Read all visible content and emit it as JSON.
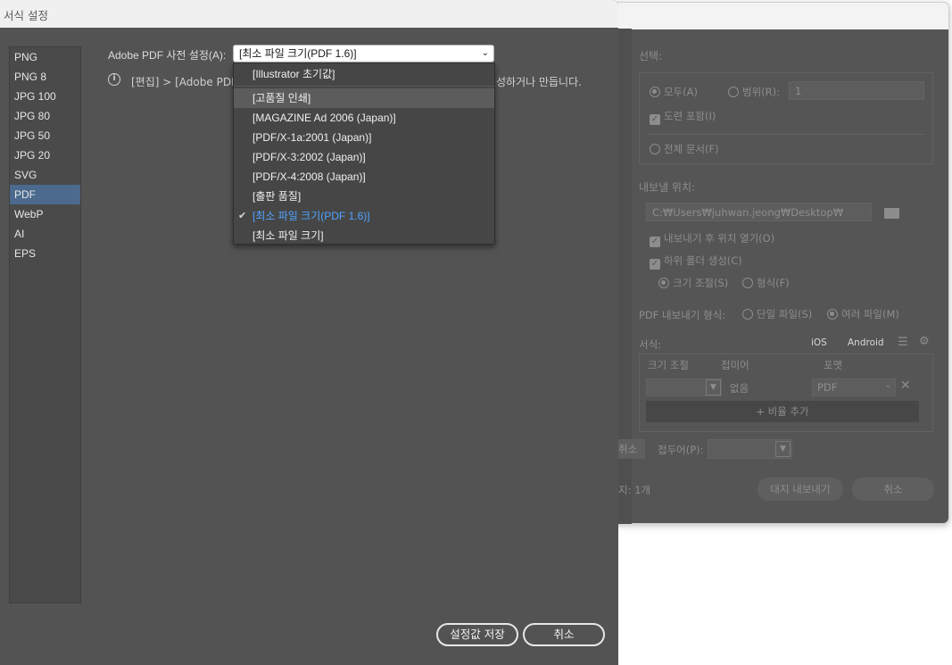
{
  "main_dialog": {
    "title": "서식 설정",
    "formats": [
      "PNG",
      "PNG 8",
      "JPG 100",
      "JPG 80",
      "JPG 50",
      "JPG 20",
      "SVG",
      "PDF",
      "WebP",
      "AI",
      "EPS"
    ],
    "selected_format": "PDF",
    "preset_label": "Adobe PDF 사전 설정(A):",
    "preset_value": "[최소 파일 크기(PDF 1.6)]",
    "info_prefix": "[편집] > [Adobe PDF",
    "info_suffix": "성하거나 만듭니다.",
    "dropdown_options": [
      "[Illustrator 초기값]",
      "[고품질 인쇄]",
      "[MAGAZINE Ad 2006 (Japan)]",
      "[PDF/X-1a:2001 (Japan)]",
      "[PDF/X-3:2002 (Japan)]",
      "[PDF/X-4:2008 (Japan)]",
      "[출판 품질]",
      "[최소 파일 크기(PDF 1.6)]",
      "[최소 파일 크기]"
    ],
    "hovered_option_index": 1,
    "checked_option_index": 7,
    "save_button": "설정값 저장",
    "cancel_button": "취소",
    "colors": {
      "selection": "#4b6a8e",
      "checked_text": "#4fa3ff",
      "panel": "#535353"
    }
  },
  "background_dialog": {
    "select_label": "선택:",
    "radio_all": "모두(A)",
    "radio_range": "범위(R):",
    "range_value": "1",
    "include_bleed": "도련 포함(I)",
    "entire_document": "전체 문서(F)",
    "export_location_label": "내보낼 위치:",
    "path": "C:₩Users₩juhwan.jeong₩Desktop₩",
    "open_after_export": "내보내기 후 위치 열기(O)",
    "create_subfolders": "하위 폴더 생성(C)",
    "radio_scale": "크기 조절(S)",
    "radio_format": "형식(F)",
    "pdf_export_type_label": "PDF 내보내기 형식:",
    "radio_single_file": "단일 파일(S)",
    "radio_multiple_files": "여러 파일(M)",
    "formats_label": "서식:",
    "ios_label": "iOS",
    "android_label": "Android",
    "col_scale": "크기 조절",
    "col_suffix": "접미어",
    "col_format": "포맷",
    "suffix_value": "없음",
    "format_value": "PDF",
    "add_scale_button": "+ 비율 추가",
    "cancel_small": "취소",
    "prefix_label": "접두어(P):",
    "count_text": "지: 1개",
    "export_artboards_button": "대지 내보내기",
    "cancel_button": "취소"
  }
}
